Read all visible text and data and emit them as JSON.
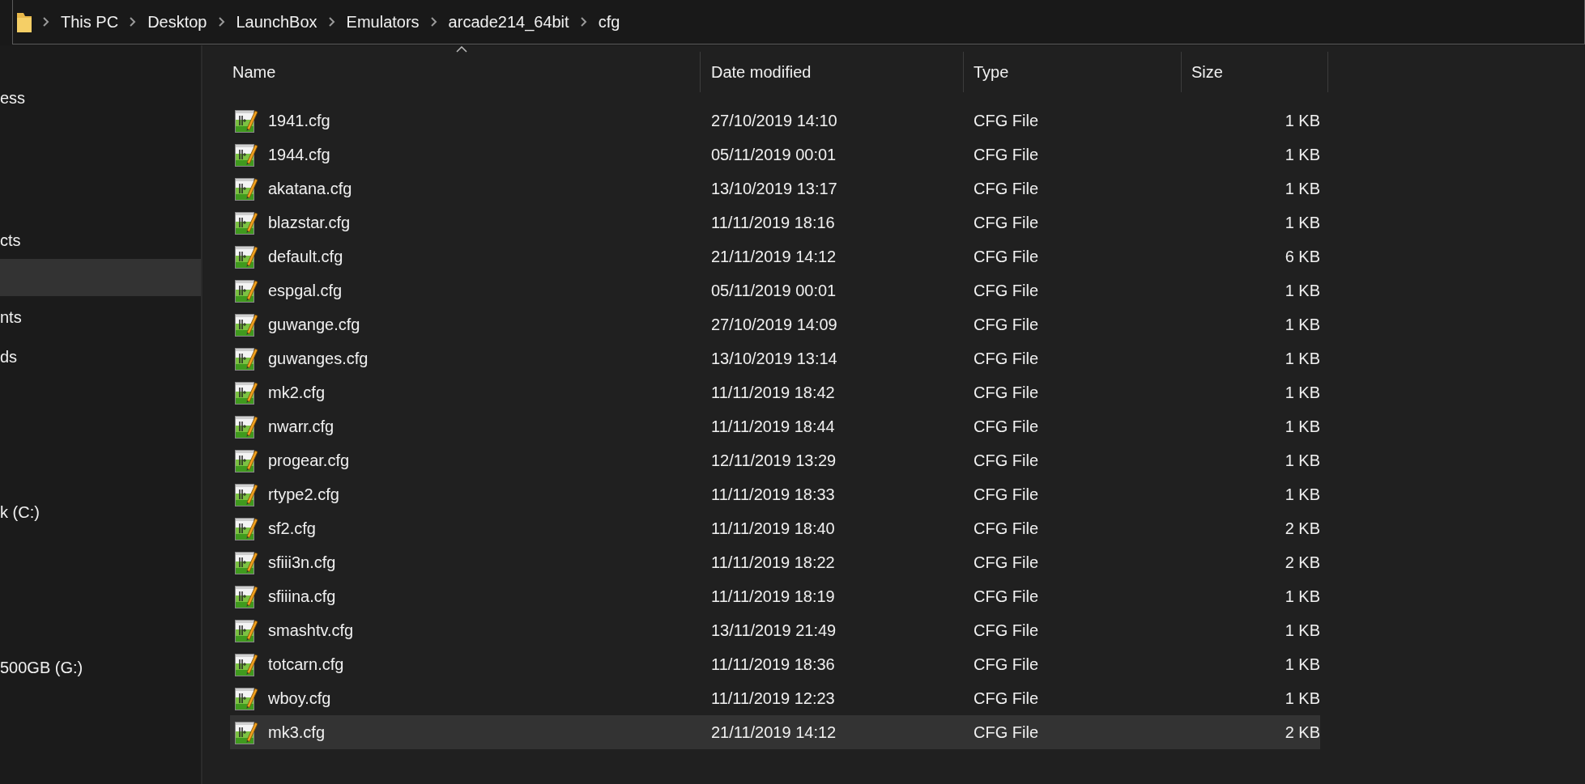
{
  "address_bar": {
    "segments": [
      "This PC",
      "Desktop",
      "LaunchBox",
      "Emulators",
      "arcade214_64bit",
      "cfg"
    ]
  },
  "sidebar": {
    "items": [
      {
        "label": "ess",
        "selected": false
      },
      {
        "label": "cts",
        "selected": false
      },
      {
        "selected": true
      },
      {
        "label": "nts",
        "selected": false
      },
      {
        "label": "ds",
        "selected": false
      },
      {
        "label": "k (C:)",
        "selected": false
      },
      {
        "label": "500GB (G:)",
        "selected": false
      }
    ]
  },
  "table": {
    "columns": [
      "Name",
      "Date modified",
      "Type",
      "Size"
    ],
    "rows": [
      {
        "name": "1941.cfg",
        "date": "27/10/2019 14:10",
        "type": "CFG File",
        "size": "1 KB",
        "selected": false
      },
      {
        "name": "1944.cfg",
        "date": "05/11/2019 00:01",
        "type": "CFG File",
        "size": "1 KB",
        "selected": false
      },
      {
        "name": "akatana.cfg",
        "date": "13/10/2019 13:17",
        "type": "CFG File",
        "size": "1 KB",
        "selected": false
      },
      {
        "name": "blazstar.cfg",
        "date": "11/11/2019 18:16",
        "type": "CFG File",
        "size": "1 KB",
        "selected": false
      },
      {
        "name": "default.cfg",
        "date": "21/11/2019 14:12",
        "type": "CFG File",
        "size": "6 KB",
        "selected": false
      },
      {
        "name": "espgal.cfg",
        "date": "05/11/2019 00:01",
        "type": "CFG File",
        "size": "1 KB",
        "selected": false
      },
      {
        "name": "guwange.cfg",
        "date": "27/10/2019 14:09",
        "type": "CFG File",
        "size": "1 KB",
        "selected": false
      },
      {
        "name": "guwanges.cfg",
        "date": "13/10/2019 13:14",
        "type": "CFG File",
        "size": "1 KB",
        "selected": false
      },
      {
        "name": "mk2.cfg",
        "date": "11/11/2019 18:42",
        "type": "CFG File",
        "size": "1 KB",
        "selected": false
      },
      {
        "name": "nwarr.cfg",
        "date": "11/11/2019 18:44",
        "type": "CFG File",
        "size": "1 KB",
        "selected": false
      },
      {
        "name": "progear.cfg",
        "date": "12/11/2019 13:29",
        "type": "CFG File",
        "size": "1 KB",
        "selected": false
      },
      {
        "name": "rtype2.cfg",
        "date": "11/11/2019 18:33",
        "type": "CFG File",
        "size": "1 KB",
        "selected": false
      },
      {
        "name": "sf2.cfg",
        "date": "11/11/2019 18:40",
        "type": "CFG File",
        "size": "2 KB",
        "selected": false
      },
      {
        "name": "sfiii3n.cfg",
        "date": "11/11/2019 18:22",
        "type": "CFG File",
        "size": "2 KB",
        "selected": false
      },
      {
        "name": "sfiiina.cfg",
        "date": "11/11/2019 18:19",
        "type": "CFG File",
        "size": "1 KB",
        "selected": false
      },
      {
        "name": "smashtv.cfg",
        "date": "13/11/2019 21:49",
        "type": "CFG File",
        "size": "1 KB",
        "selected": false
      },
      {
        "name": "totcarn.cfg",
        "date": "11/11/2019 18:36",
        "type": "CFG File",
        "size": "1 KB",
        "selected": false
      },
      {
        "name": "wboy.cfg",
        "date": "11/11/2019 12:23",
        "type": "CFG File",
        "size": "1 KB",
        "selected": false
      },
      {
        "name": "mk3.cfg",
        "date": "21/11/2019 14:12",
        "type": "CFG File",
        "size": "2 KB",
        "selected": true
      }
    ]
  }
}
